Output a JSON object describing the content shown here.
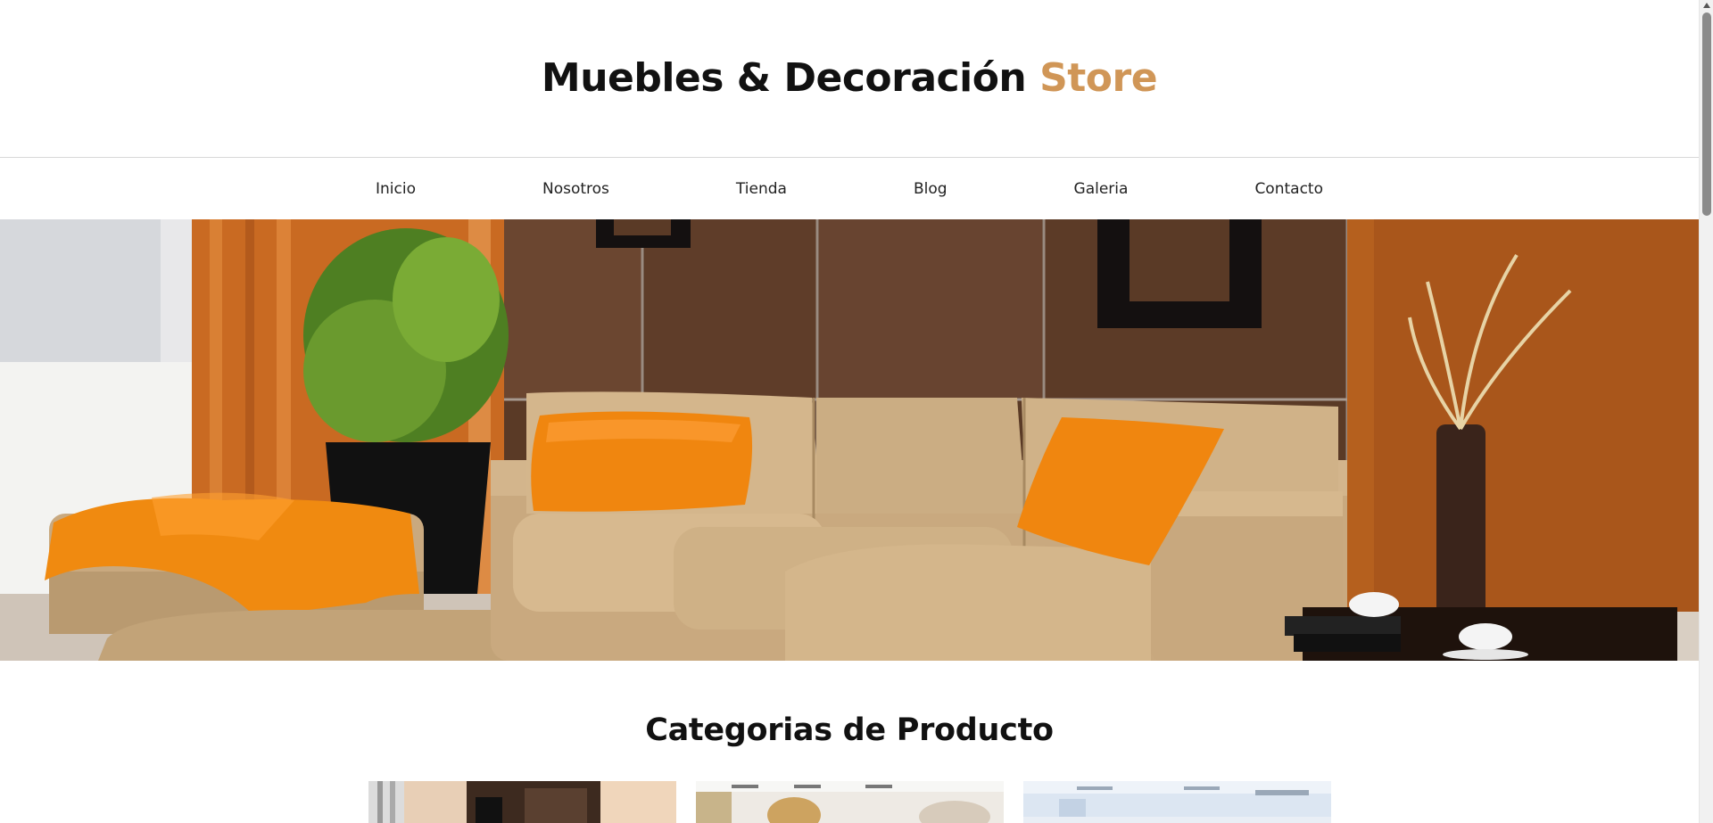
{
  "header": {
    "logo_main": "Muebles & Decoración ",
    "logo_accent": "Store"
  },
  "nav": {
    "items": [
      "Inicio",
      "Nosotros",
      "Tienda",
      "Blog",
      "Galeria",
      "Contacto"
    ]
  },
  "hero": {
    "image": "living-room-sofa-image"
  },
  "categories": {
    "title": "Categorias de Producto",
    "cards": [
      "category-card-image-1",
      "category-card-image-2",
      "category-card-image-3"
    ]
  },
  "colors": {
    "accent": "#d09657",
    "sofa": "#c9a97f",
    "pillow": "#f0860f",
    "wall_wood": "#5a3a26",
    "wall_orange": "#b5601e"
  }
}
